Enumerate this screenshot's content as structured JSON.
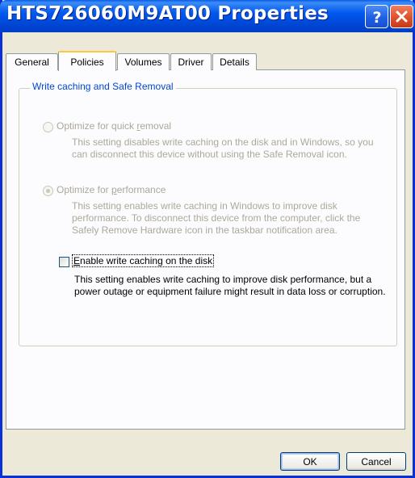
{
  "window": {
    "title": "HTS726060M9AT00 Properties",
    "help_icon": "help-icon",
    "close_icon": "close-icon",
    "title_color": "#0058ee"
  },
  "tabs": [
    {
      "label": "General",
      "active": false
    },
    {
      "label": "Policies",
      "active": true
    },
    {
      "label": "Volumes",
      "active": false
    },
    {
      "label": "Driver",
      "active": false
    },
    {
      "label": "Details",
      "active": false
    }
  ],
  "group": {
    "label": "Write caching and Safe Removal",
    "options": [
      {
        "label_pre": "Optimize for quick ",
        "label_acc": "r",
        "label_post": "emoval",
        "selected": false,
        "enabled": false,
        "description": "This setting disables write caching on the disk and in Windows, so you can disconnect this device without using the Safe Removal icon."
      },
      {
        "label_pre": "Optimize for ",
        "label_acc": "p",
        "label_post": "erformance",
        "selected": true,
        "enabled": false,
        "description": "This setting enables write caching in Windows to improve disk performance. To disconnect this device from the computer, click the Safely Remove Hardware icon in the taskbar notification area."
      }
    ],
    "checkbox": {
      "label_pre": "",
      "label_acc": "E",
      "label_post": "nable write caching on the disk",
      "checked": false,
      "description": "This setting enables write caching to improve disk performance, but a power outage or equipment failure might result in data loss or corruption."
    }
  },
  "buttons": {
    "ok": "OK",
    "cancel": "Cancel"
  }
}
